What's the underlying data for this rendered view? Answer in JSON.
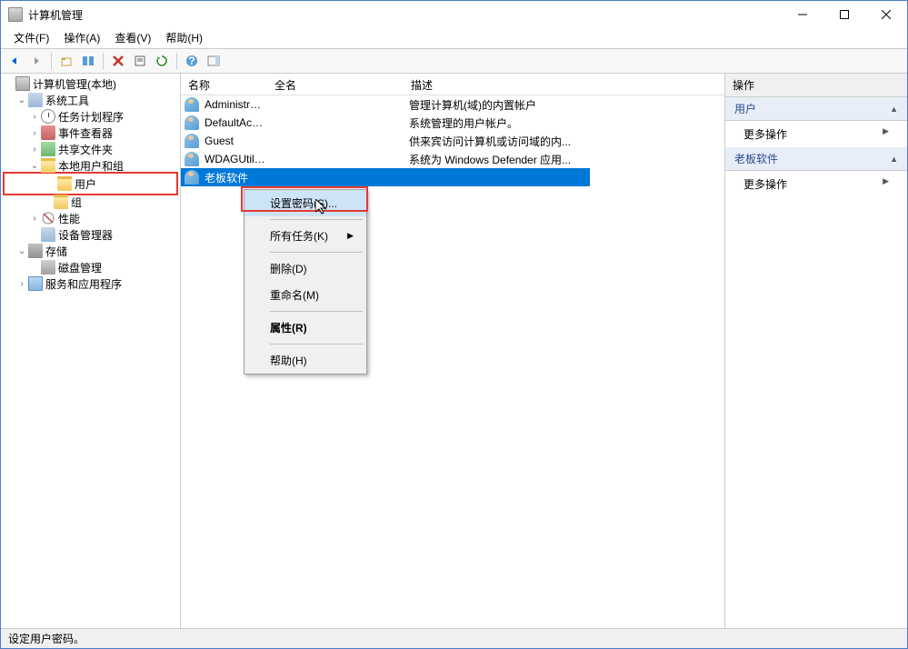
{
  "window": {
    "title": "计算机管理"
  },
  "menubar": [
    {
      "label": "文件(F)"
    },
    {
      "label": "操作(A)"
    },
    {
      "label": "查看(V)"
    },
    {
      "label": "帮助(H)"
    }
  ],
  "tree": {
    "root": "计算机管理(本地)",
    "system_tools": "系统工具",
    "task_scheduler": "任务计划程序",
    "event_viewer": "事件查看器",
    "shared_folders": "共享文件夹",
    "local_users_groups": "本地用户和组",
    "users": "用户",
    "groups": "组",
    "performance": "性能",
    "device_manager": "设备管理器",
    "storage": "存储",
    "disk_management": "磁盘管理",
    "services_apps": "服务和应用程序"
  },
  "list": {
    "columns": {
      "name": "名称",
      "fullname": "全名",
      "description": "描述"
    },
    "rows": [
      {
        "name": "Administrat...",
        "fullname": "",
        "desc": "管理计算机(域)的内置帐户"
      },
      {
        "name": "DefaultAcc...",
        "fullname": "",
        "desc": "系统管理的用户帐户。"
      },
      {
        "name": "Guest",
        "fullname": "",
        "desc": "供来宾访问计算机或访问域的内..."
      },
      {
        "name": "WDAGUtilit...",
        "fullname": "",
        "desc": "系统为 Windows Defender 应用..."
      },
      {
        "name": "老板软件",
        "fullname": "",
        "desc": ""
      }
    ]
  },
  "context_menu": {
    "set_password": "设置密码(S)...",
    "all_tasks": "所有任务(K)",
    "delete": "删除(D)",
    "rename": "重命名(M)",
    "properties": "属性(R)",
    "help": "帮助(H)"
  },
  "actions": {
    "title": "操作",
    "users_section": "用户",
    "selected_section": "老板软件",
    "more_ops": "更多操作"
  },
  "statusbar": {
    "text": "设定用户密码。"
  }
}
